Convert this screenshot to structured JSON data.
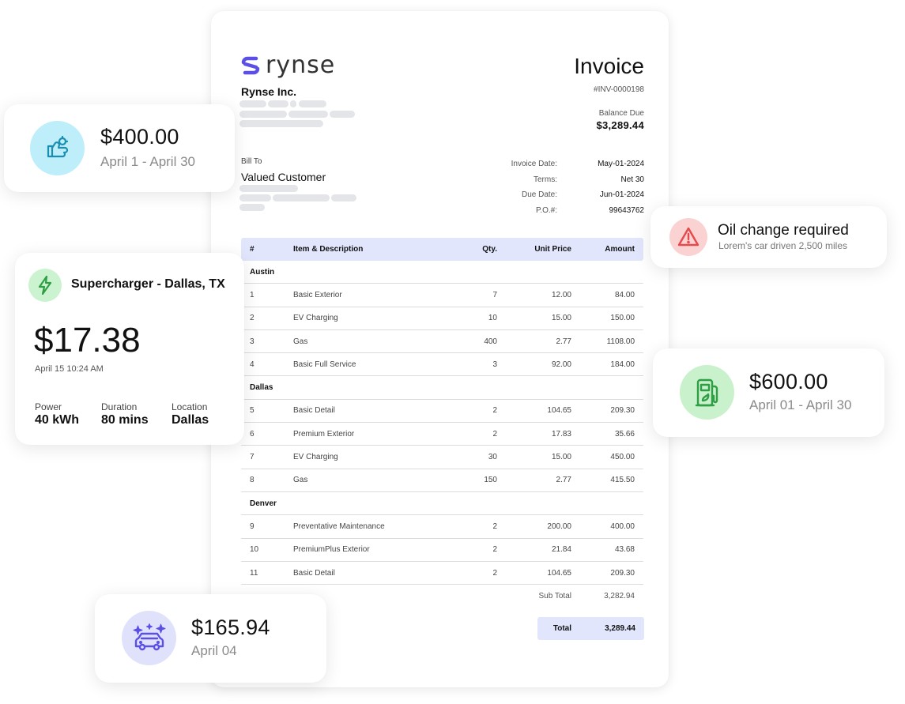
{
  "brand": {
    "logo_text": "rynse",
    "company": "Rynse Inc."
  },
  "invoice": {
    "title": "Invoice",
    "number": "#INV-0000198",
    "balance_label": "Balance Due",
    "balance_value": "$3,289.44",
    "bill_to_label": "Bill To",
    "bill_to_name": "Valued Customer",
    "meta": [
      {
        "label": "Invoice Date:",
        "value": "May-01-2024"
      },
      {
        "label": "Terms:",
        "value": "Net 30"
      },
      {
        "label": "Due Date:",
        "value": "Jun-01-2024"
      },
      {
        "label": "P.O.#:",
        "value": "99643762"
      }
    ],
    "columns": [
      "#",
      "Item & Description",
      "Qty.",
      "Unit Price",
      "Amount"
    ],
    "groups": [
      {
        "name": "Austin",
        "rows": [
          [
            "1",
            "Basic Exterior",
            "7",
            "12.00",
            "84.00"
          ],
          [
            "2",
            "EV Charging",
            "10",
            "15.00",
            "150.00"
          ],
          [
            "3",
            "Gas",
            "400",
            "2.77",
            "1108.00"
          ],
          [
            "4",
            "Basic Full Service",
            "3",
            "92.00",
            "184.00"
          ]
        ]
      },
      {
        "name": "Dallas",
        "rows": [
          [
            "5",
            "Basic Detail",
            "2",
            "104.65",
            "209.30"
          ],
          [
            "6",
            "Premium Exterior",
            "2",
            "17.83",
            "35.66"
          ],
          [
            "7",
            "EV Charging",
            "30",
            "15.00",
            "450.00"
          ],
          [
            "8",
            "Gas",
            "150",
            "2.77",
            "415.50"
          ]
        ]
      },
      {
        "name": "Denver",
        "rows": [
          [
            "9",
            "Preventative Maintenance",
            "2",
            "200.00",
            "400.00"
          ],
          [
            "10",
            "PremiumPlus Exterior",
            "2",
            "21.84",
            "43.68"
          ],
          [
            "11",
            "Basic Detail",
            "2",
            "104.65",
            "209.30"
          ]
        ]
      }
    ],
    "subtotal_label": "Sub Total",
    "subtotal_value": "3,282.94",
    "total_label": "Total",
    "total_value": "3,289.44"
  },
  "cards": {
    "service": {
      "icon": "wrench-hand-icon",
      "amount": "$400.00",
      "period": "April 1 - April 30"
    },
    "charger": {
      "icon": "lightning-bolt-icon",
      "title": "Supercharger - Dallas, TX",
      "amount": "$17.38",
      "timestamp": "April 15 10:24 AM",
      "stats": [
        {
          "label": "Power",
          "value": "40 kWh"
        },
        {
          "label": "Duration",
          "value": "80 mins"
        },
        {
          "label": "Location",
          "value": "Dallas"
        }
      ]
    },
    "alert": {
      "icon": "warning-triangle-icon",
      "title": "Oil change required",
      "subtitle": "Lorem's car driven 2,500 miles"
    },
    "fuel": {
      "icon": "fuel-pump-icon",
      "amount": "$600.00",
      "period": "April 01 - April 30"
    },
    "wash": {
      "icon": "car-sparkle-icon",
      "amount": "$165.94",
      "period": "April 04"
    }
  },
  "colors": {
    "brand": "#5b4fe6",
    "table_header": "#e1e6fd",
    "service_bg": "#bdeefa",
    "charger_bg": "#cbf3cf",
    "alert_bg": "#fbd2d2",
    "alert_icon": "#e5484d",
    "fuel_bg": "#c9f1cc",
    "wash_bg": "#e0e2fb"
  }
}
